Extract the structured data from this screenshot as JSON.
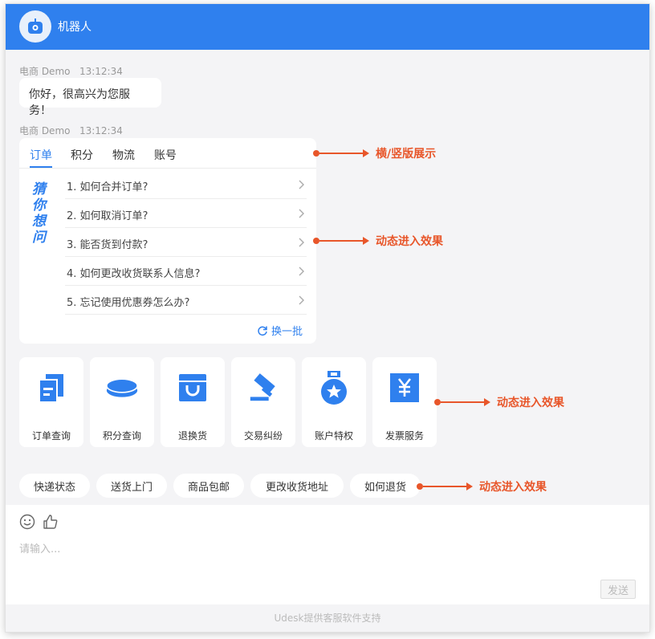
{
  "header": {
    "title": "机器人",
    "avatar_icon": "robot-icon"
  },
  "messages": [
    {
      "sender": "电商 Demo",
      "time": "13:12:34",
      "text": "你好，很高兴为您服务！"
    },
    {
      "sender": "电商 Demo",
      "time": "13:12:34"
    }
  ],
  "card": {
    "tabs": [
      "订单",
      "积分",
      "物流",
      "账号"
    ],
    "active_tab": 0,
    "guess_label": [
      "猜",
      "你",
      "想",
      "问"
    ],
    "questions": [
      "1. 如何合并订单?",
      "2. 如何取消订单?",
      "3. 能否货到付款?",
      "4. 如何更改收货联系人信息?",
      "5. 忘记使用优惠券怎么办?"
    ],
    "refresh_label": "换一批"
  },
  "tiles": [
    {
      "label": "订单查询",
      "icon": "order-docs-icon"
    },
    {
      "label": "积分查询",
      "icon": "coin-stack-icon"
    },
    {
      "label": "退换货",
      "icon": "shopping-bag-icon"
    },
    {
      "label": "交易纠纷",
      "icon": "gavel-icon"
    },
    {
      "label": "账户特权",
      "icon": "medal-icon"
    },
    {
      "label": "发票服务",
      "icon": "invoice-yen-icon"
    }
  ],
  "chips": [
    "快递状态",
    "送货上门",
    "商品包邮",
    "更改收货地址",
    "如何退货"
  ],
  "input": {
    "placeholder": "请输入...",
    "send_label": "发送",
    "emoji_icon": "smile-icon",
    "like_icon": "thumbs-up-icon"
  },
  "footer": {
    "text": "Udesk提供客服软件支持"
  },
  "annotations": [
    "横/竖版展示",
    "动态进入效果",
    "动态进入效果",
    "动态进入效果"
  ],
  "colors": {
    "brand": "#2f80ee",
    "annotation": "#e8562a",
    "background": "#f4f4f6"
  }
}
